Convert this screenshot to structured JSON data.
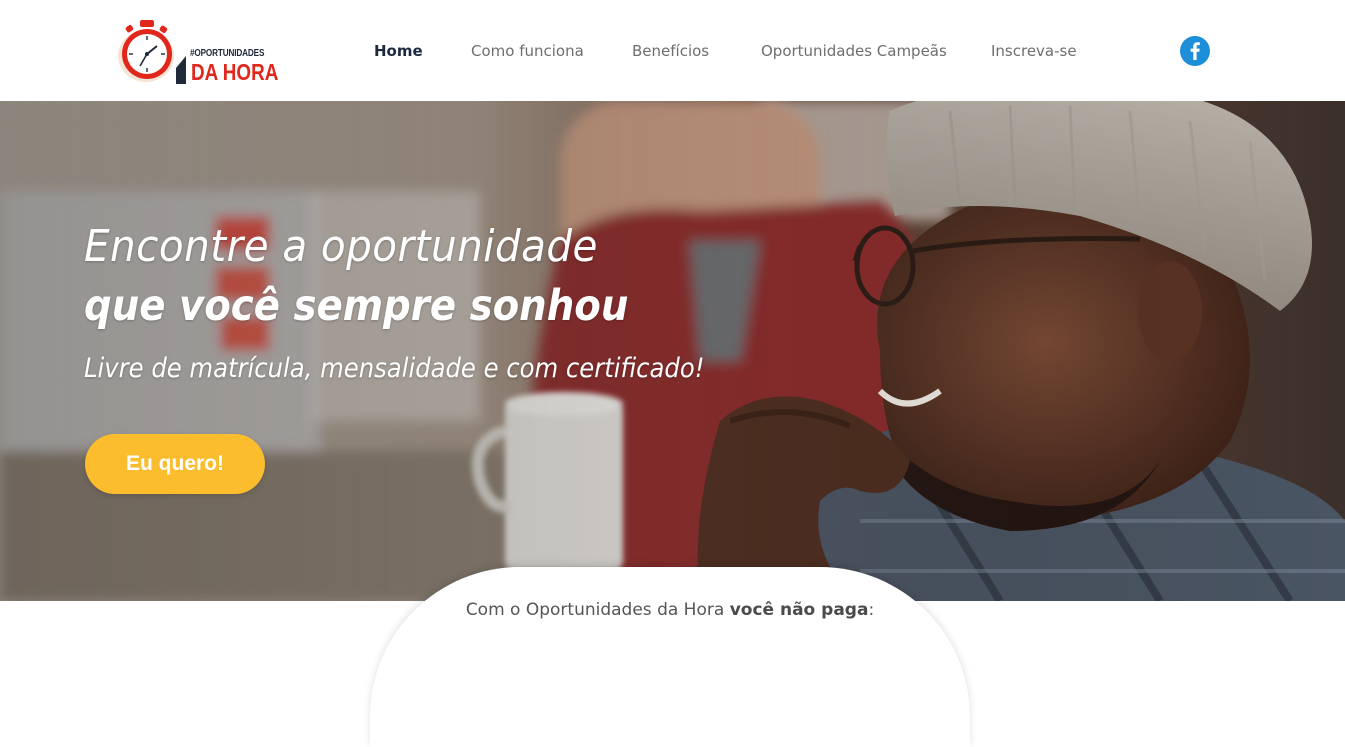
{
  "logo": {
    "small_text": "#OPORTUNIDADES",
    "big_text": "DA HORA"
  },
  "nav": {
    "items": [
      {
        "label": "Home",
        "active": true
      },
      {
        "label": "Como funciona",
        "active": false
      },
      {
        "label": "Benefícios",
        "active": false
      },
      {
        "label": "Oportunidades Campeãs",
        "active": false
      },
      {
        "label": "Inscreva-se",
        "active": false
      }
    ]
  },
  "social": {
    "facebook_icon": "facebook-icon",
    "facebook_glyph": "f"
  },
  "hero": {
    "line1": "Encontre a oportunidade",
    "line2": "que você sempre sonhou",
    "line3": "Livre de matrícula, mensalidade e com certificado!",
    "cta_label": "Eu quero!"
  },
  "bottom": {
    "text_prefix": "Com o Oportunidades da Hora ",
    "text_bold": "você não paga",
    "text_suffix": ":"
  },
  "colors": {
    "accent_red": "#e1261c",
    "navy": "#1b2a3e",
    "cta_yellow": "#fbbd2e",
    "facebook_blue": "#1d8ed8"
  }
}
